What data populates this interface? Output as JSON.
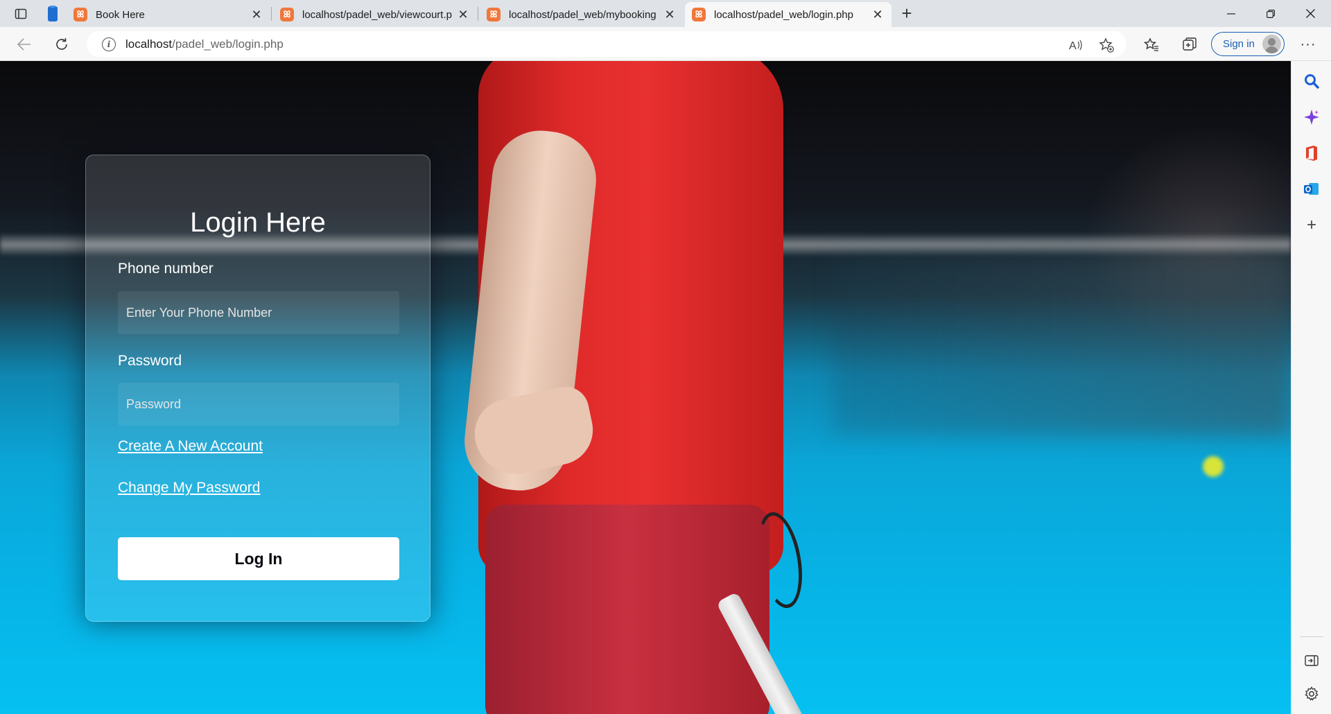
{
  "browser": {
    "tabs": [
      {
        "title": "Book Here",
        "active": false
      },
      {
        "title": "localhost/padel_web/viewcourt.p",
        "active": false
      },
      {
        "title": "localhost/padel_web/mybooking",
        "active": false
      },
      {
        "title": "localhost/padel_web/login.php",
        "active": true
      }
    ],
    "address": {
      "host": "localhost",
      "path": "/padel_web/login.php"
    },
    "sign_in_label": "Sign in",
    "icons": {
      "back": "back-arrow-icon",
      "refresh": "refresh-icon",
      "info": "site-info-icon",
      "read_aloud": "read-aloud-icon",
      "add_favorite": "add-favorite-icon",
      "favorites": "favorites-icon",
      "collections": "collections-icon",
      "more": "more-icon"
    },
    "sidebar_icons": [
      "search-icon",
      "copilot-icon",
      "office-icon",
      "outlook-icon",
      "add-icon",
      "hide-sidebar-icon",
      "settings-icon"
    ]
  },
  "login": {
    "title": "Login Here",
    "phone_label": "Phone number",
    "phone_placeholder": "Enter Your Phone Number",
    "password_label": "Password",
    "password_placeholder": "Password",
    "create_account": "Create A New Account",
    "change_password": "Change My Password",
    "submit_label": "Log In"
  },
  "colors": {
    "brand_tab_icon": "#f0773a",
    "sign_in_accent": "#1a5fb4",
    "button_bg": "#ffffff",
    "button_text": "#080710"
  }
}
